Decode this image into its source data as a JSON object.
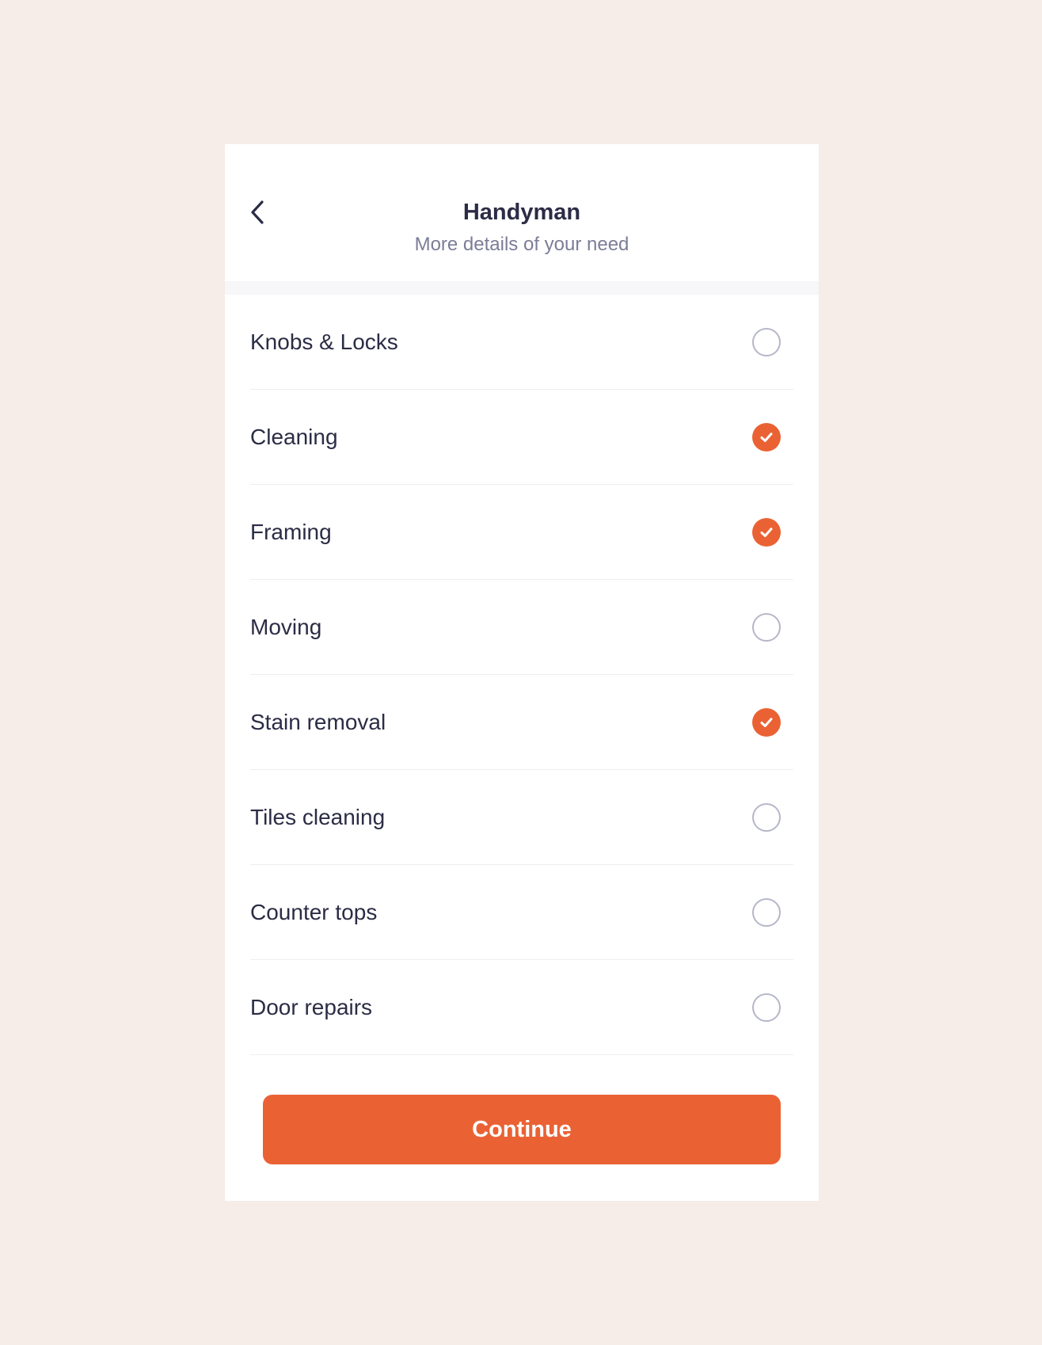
{
  "header": {
    "back_icon": "chevron-left-icon",
    "title": "Handyman",
    "subtitle": "More details of your need"
  },
  "options": [
    {
      "label": "Knobs & Locks",
      "checked": false
    },
    {
      "label": "Cleaning",
      "checked": true
    },
    {
      "label": "Framing",
      "checked": true
    },
    {
      "label": "Moving",
      "checked": false
    },
    {
      "label": "Stain removal",
      "checked": true
    },
    {
      "label": "Tiles cleaning",
      "checked": false
    },
    {
      "label": "Counter tops",
      "checked": false
    },
    {
      "label": "Door repairs",
      "checked": false
    }
  ],
  "footer": {
    "continue_label": "Continue"
  },
  "colors": {
    "background": "#f6ece8",
    "accent": "#ea6234",
    "text": "#2b2c45",
    "muted_text": "#7b7d98",
    "unchecked_border": "#b5b7c9"
  }
}
